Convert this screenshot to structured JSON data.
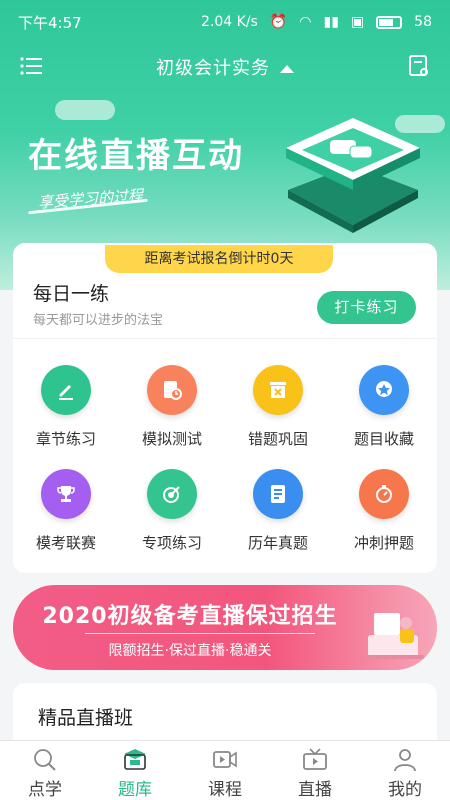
{
  "status": {
    "time": "下午4:57",
    "speed": "2.04 K/s",
    "battery": "58"
  },
  "header": {
    "title": "初级会计实务"
  },
  "banner": {
    "title": "在线直播互动",
    "subtitle": "享受学习的过程"
  },
  "countdown": "距离考试报名倒计时0天",
  "daily": {
    "title": "每日一练",
    "subtitle": "每天都可以进步的法宝",
    "button": "打卡练习"
  },
  "grid": [
    {
      "label": "章节练习",
      "icon": "pencil-icon",
      "color": "#2fc48f"
    },
    {
      "label": "模拟测试",
      "icon": "clock-doc-icon",
      "color": "#f7825c"
    },
    {
      "label": "错题巩固",
      "icon": "error-bin-icon",
      "color": "#f8c219"
    },
    {
      "label": "题目收藏",
      "icon": "star-badge-icon",
      "color": "#3e94f2"
    },
    {
      "label": "模考联赛",
      "icon": "trophy-icon",
      "color": "#a55ff0"
    },
    {
      "label": "专项练习",
      "icon": "target-icon",
      "color": "#33c48f"
    },
    {
      "label": "历年真题",
      "icon": "document-icon",
      "color": "#3a8ef0"
    },
    {
      "label": "冲刺押题",
      "icon": "stopwatch-icon",
      "color": "#f7774d"
    }
  ],
  "promo": {
    "title": "2020初级备考直播保过招生",
    "subtitle": "限额招生·保过直播·稳通关"
  },
  "live": {
    "title": "精品直播班"
  },
  "tabs": [
    {
      "label": "点学",
      "icon": "search-icon",
      "active": false
    },
    {
      "label": "题库",
      "icon": "question-bank-icon",
      "active": true
    },
    {
      "label": "课程",
      "icon": "video-icon",
      "active": false
    },
    {
      "label": "直播",
      "icon": "tv-icon",
      "active": false
    },
    {
      "label": "我的",
      "icon": "user-icon",
      "active": false
    }
  ]
}
